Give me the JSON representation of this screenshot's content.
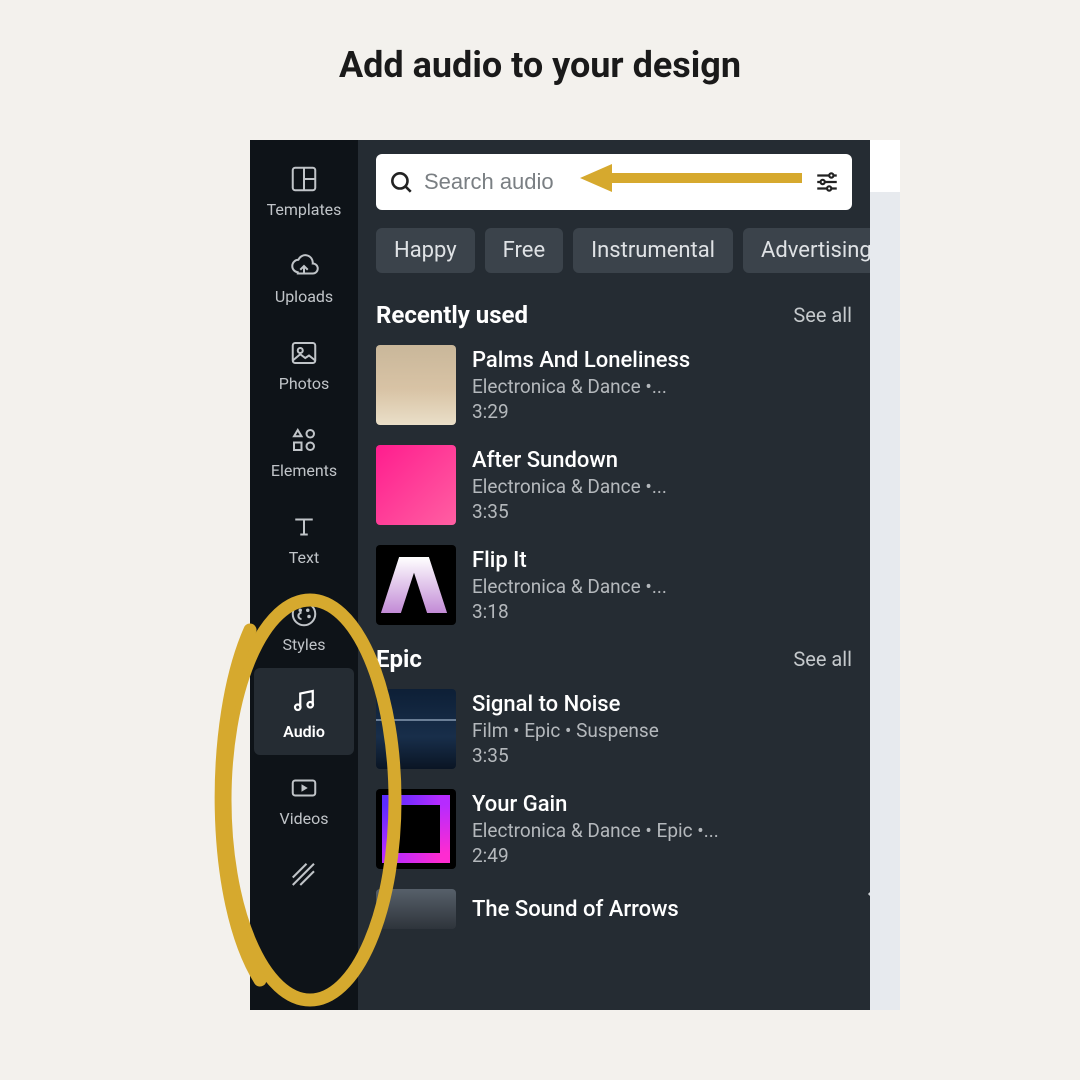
{
  "colors": {
    "accent_annotation": "#d6a92e"
  },
  "page_title": "Add audio to your design",
  "nav": {
    "items": [
      {
        "label": "Templates"
      },
      {
        "label": "Uploads"
      },
      {
        "label": "Photos"
      },
      {
        "label": "Elements"
      },
      {
        "label": "Text"
      },
      {
        "label": "Styles"
      },
      {
        "label": "Audio"
      },
      {
        "label": "Videos"
      }
    ],
    "active_index": 6
  },
  "search": {
    "placeholder": "Search audio"
  },
  "chips": [
    "Happy",
    "Free",
    "Instrumental",
    "Advertising"
  ],
  "sections": [
    {
      "title": "Recently used",
      "see_all": "See all",
      "tracks": [
        {
          "title": "Palms And Loneliness",
          "meta": "Electronica & Dance •...",
          "duration": "3:29"
        },
        {
          "title": "After Sundown",
          "meta": "Electronica & Dance •...",
          "duration": "3:35"
        },
        {
          "title": "Flip It",
          "meta": "Electronica & Dance •...",
          "duration": "3:18"
        }
      ]
    },
    {
      "title": "Epic",
      "see_all": "See all",
      "tracks": [
        {
          "title": "Signal to Noise",
          "meta": "Film • Epic • Suspense",
          "duration": "3:35"
        },
        {
          "title": "Your Gain",
          "meta": "Electronica & Dance • Epic •...",
          "duration": "2:49"
        },
        {
          "title": "The Sound of Arrows",
          "meta": "",
          "duration": ""
        }
      ]
    }
  ]
}
